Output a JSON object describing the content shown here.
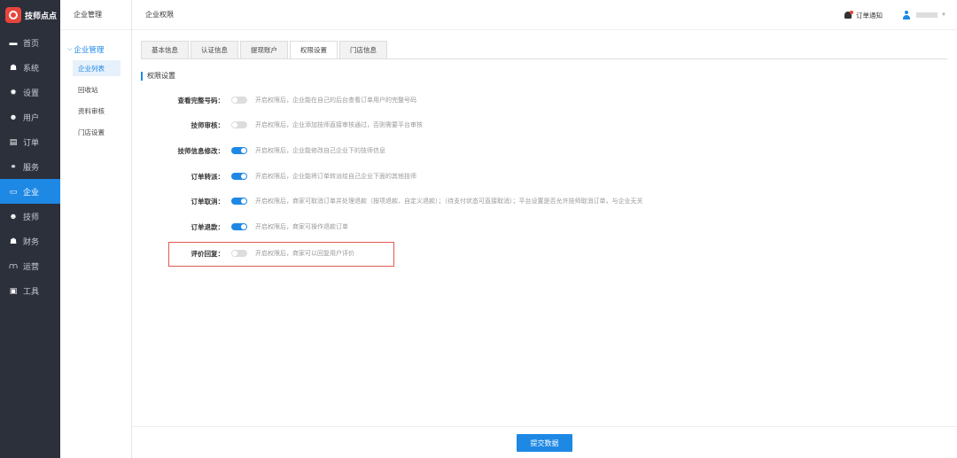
{
  "app": {
    "title": "技师点点"
  },
  "sidebar": {
    "items": [
      {
        "label": "首页",
        "icon": "monitor-icon",
        "glyph": "▬"
      },
      {
        "label": "系统",
        "icon": "org-icon",
        "glyph": "☗"
      },
      {
        "label": "设置",
        "icon": "gear-icon",
        "glyph": "✹"
      },
      {
        "label": "用户",
        "icon": "user-icon",
        "glyph": "☻"
      },
      {
        "label": "订单",
        "icon": "order-icon",
        "glyph": "▤"
      },
      {
        "label": "服务",
        "icon": "link-icon",
        "glyph": "⚭"
      },
      {
        "label": "企业",
        "icon": "enterprise-icon",
        "glyph": "▭"
      },
      {
        "label": "技师",
        "icon": "technician-icon",
        "glyph": "☻"
      },
      {
        "label": "财务",
        "icon": "finance-icon",
        "glyph": "☗"
      },
      {
        "label": "运营",
        "icon": "operation-icon",
        "glyph": "⩋"
      },
      {
        "label": "工具",
        "icon": "toolbox-icon",
        "glyph": "▣"
      }
    ],
    "active": "企业"
  },
  "subnav": {
    "title": "企业管理",
    "group": "企业管理",
    "items": [
      "企业列表",
      "回收站",
      "资料审核",
      "门店设置"
    ],
    "active": "企业列表"
  },
  "header": {
    "breadcrumb": "企业权限",
    "notice": "订单通知"
  },
  "tabs": [
    "基本信息",
    "认证信息",
    "提现账户",
    "权限设置",
    "门店信息"
  ],
  "active_tab": "权限设置",
  "section_title": "权限设置",
  "permissions": [
    {
      "label": "查看完整号码：",
      "on": false,
      "desc": "开启权限后，企业能在自己的后台查看订单用户的完整号码"
    },
    {
      "label": "技师审核：",
      "on": false,
      "desc": "开启权限后，企业添加技师直接审核通过，否则需要平台审核"
    },
    {
      "label": "技师信息修改：",
      "on": true,
      "desc": "开启权限后，企业能修改自己企业下的技师信息"
    },
    {
      "label": "订单转派：",
      "on": true,
      "desc": "开启权限后，企业能将订单转派给自己企业下面的其他技师"
    },
    {
      "label": "订单取消：",
      "on": true,
      "desc": "开启权限后，商家可取消订单并处理退款（按项退款、自定义退款）；（待支付状态可直接取消）；平台设置是否允许技师取消订单，与企业无关"
    },
    {
      "label": "订单退款：",
      "on": true,
      "desc": "开启权限后，商家可操作退款订单"
    },
    {
      "label": "评价回复：",
      "on": false,
      "desc": "开启权限后，商家可以回复用户评价"
    }
  ],
  "submit_label": "提交数据",
  "colors": {
    "accent": "#1e88e5",
    "sidebar_bg": "#2b303b",
    "highlight": "#e05a4f"
  }
}
